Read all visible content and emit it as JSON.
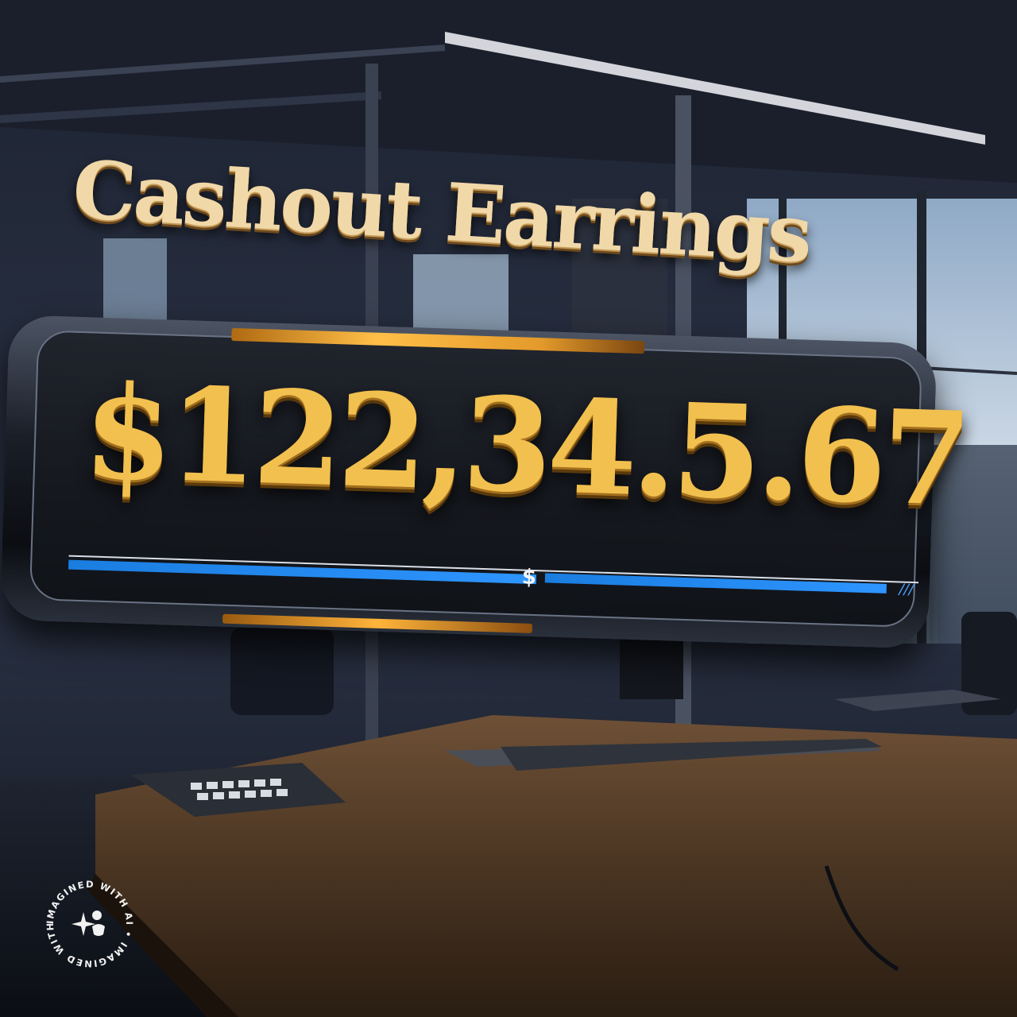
{
  "title": "Cashout Earrings",
  "amount": "$122,34.5.67",
  "progress": {
    "fill_fraction": 0.55,
    "marker_glyph": "$"
  },
  "watermark": {
    "ring_text": "IMAGINED WITH AI • IMAGINED WITH AI •",
    "icon": "sparkle-people-icon"
  },
  "colors": {
    "gold": "#f2c04e",
    "blue": "#2e95ff",
    "panel": "#15181e"
  }
}
